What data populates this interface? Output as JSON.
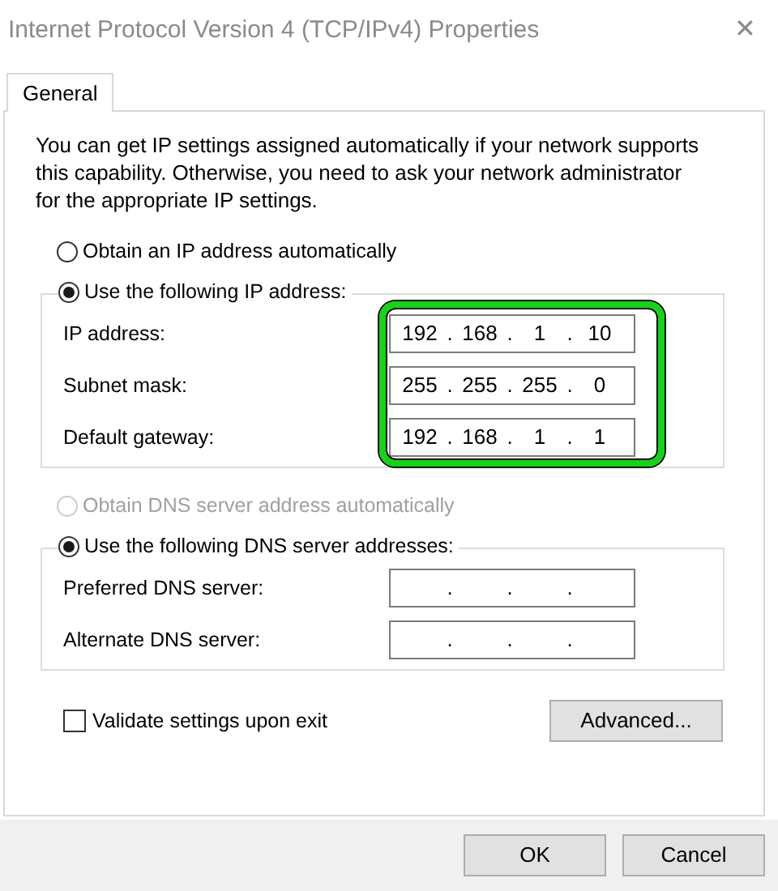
{
  "window": {
    "title": "Internet Protocol Version 4 (TCP/IPv4) Properties",
    "close": "✕"
  },
  "tabs": [
    {
      "label": "General",
      "selected": true
    }
  ],
  "intro": "You can get IP settings assigned automatically if your network supports this capability. Otherwise, you need to ask your network administrator for the appropriate IP settings.",
  "octet_separator": ".",
  "ip_section": {
    "options": [
      {
        "label": "Obtain an IP address automatically",
        "selected": false,
        "disabled": false
      },
      {
        "label": "Use the following IP address:",
        "selected": true,
        "disabled": false
      }
    ],
    "highlighted": true,
    "fields": [
      {
        "label": "IP address:",
        "octets": [
          "192",
          "168",
          "1",
          "10"
        ]
      },
      {
        "label": "Subnet mask:",
        "octets": [
          "255",
          "255",
          "255",
          "0"
        ]
      },
      {
        "label": "Default gateway:",
        "octets": [
          "192",
          "168",
          "1",
          "1"
        ]
      }
    ]
  },
  "dns_section": {
    "options": [
      {
        "label": "Obtain DNS server address automatically",
        "selected": false,
        "disabled": true
      },
      {
        "label": "Use the following DNS server addresses:",
        "selected": true,
        "disabled": false
      }
    ],
    "fields": [
      {
        "label": "Preferred DNS server:"
      },
      {
        "label": "Alternate DNS server:"
      }
    ]
  },
  "validate": {
    "label": "Validate settings upon exit",
    "checked": false
  },
  "buttons": {
    "advanced": "Advanced...",
    "ok": "OK",
    "cancel": "Cancel"
  }
}
